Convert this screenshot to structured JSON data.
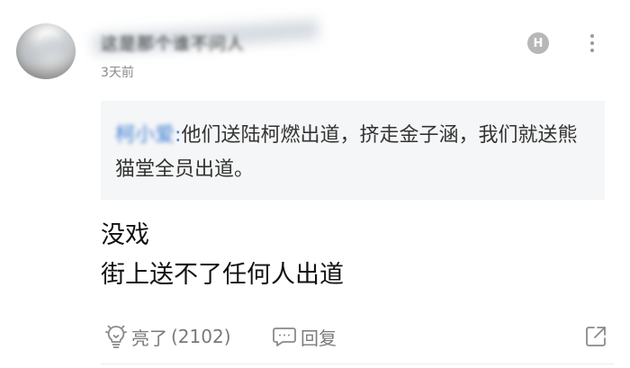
{
  "comment": {
    "username": "这是那个谁不问人",
    "timestamp": "3天前",
    "badge": "H",
    "quote": {
      "author": "柯小爱",
      "separator": ":",
      "text": "他们送陆柯燃出道，挤走金子涵，我们就送熊猫堂全员出道。"
    },
    "body_lines": [
      "没戏",
      "街上送不了任何人出道"
    ],
    "actions": {
      "like_label": "亮了",
      "like_count": "(2102)",
      "reply_label": "回复"
    }
  },
  "icons": {
    "badge": "h-badge-icon",
    "more": "more-vertical-icon",
    "like": "lightbulb-icon",
    "reply": "comment-icon",
    "share": "share-icon"
  },
  "colors": {
    "quote_author": "#3a7bd5",
    "quote_background": "#f5f6f7",
    "muted": "#7a7a7a"
  }
}
